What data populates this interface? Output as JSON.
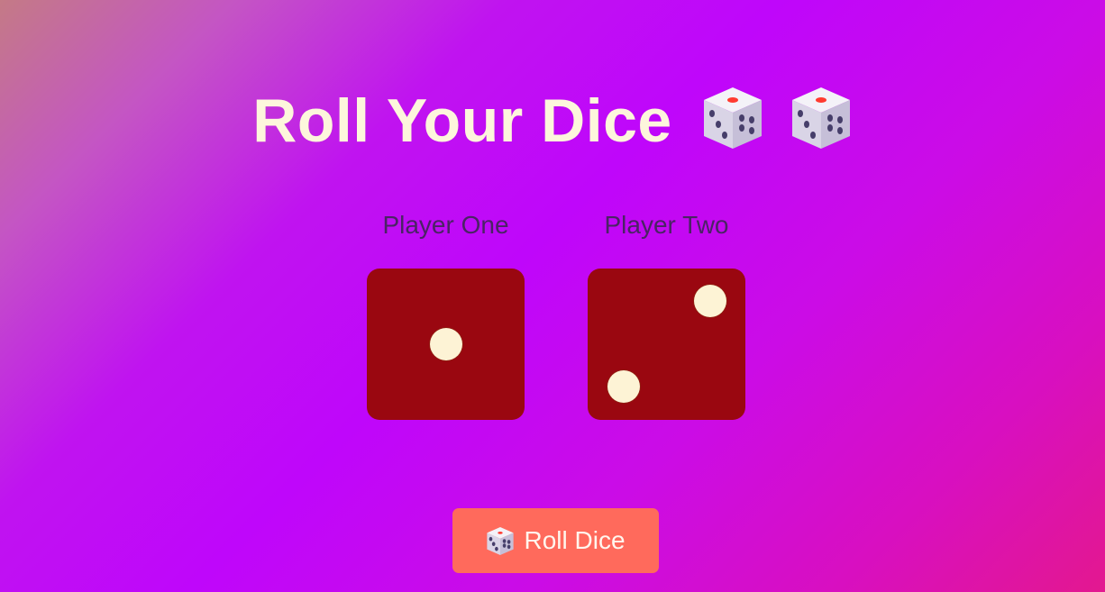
{
  "page": {
    "title": "Roll Your Dice"
  },
  "players": [
    {
      "label": "Player One",
      "value": 1
    },
    {
      "label": "Player Two",
      "value": 2
    }
  ],
  "roll_button": {
    "label": "Roll Dice",
    "icon": "dice-icon"
  },
  "colors": {
    "die_face": "#9a0710",
    "pip": "#fdf3d5",
    "button": "#ff6a5c",
    "title": "#fdf6dc",
    "player_label": "#4a2464"
  }
}
